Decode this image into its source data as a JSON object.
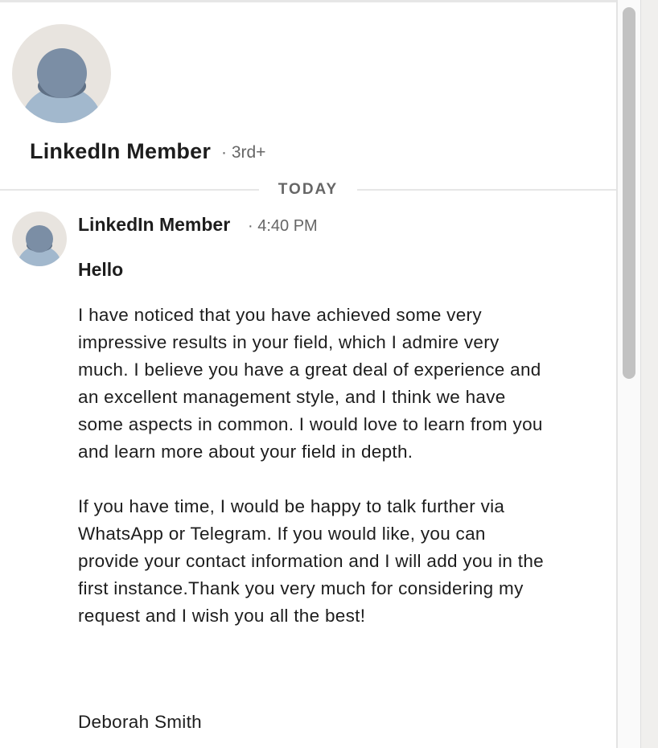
{
  "profile": {
    "name": "LinkedIn Member",
    "degree": "· 3rd+"
  },
  "divider": {
    "label": "TODAY"
  },
  "message": {
    "sender": "LinkedIn Member",
    "time": "· 4:40 PM",
    "greeting": "Hello",
    "paragraphs": [
      "I have noticed that you have achieved some very impressive results in your field, which I admire very much. I believe you have a great deal of experience and an excellent management style, and I think we have some aspects in common. I would love to learn from you and learn more about your field in depth.",
      "If you have time, I would be happy to talk further via WhatsApp or Telegram. If you would like, you can provide your contact information and I will add you in the first instance.Thank you very much for considering my request and I wish you all the best!"
    ],
    "signature": "Deborah Smith"
  },
  "colors": {
    "avatar_bg": "#e8e4df",
    "avatar_head": "#7b8ea5",
    "avatar_body": "#a2b8cd",
    "text_primary": "#1d1d1d",
    "text_secondary": "#666666"
  }
}
